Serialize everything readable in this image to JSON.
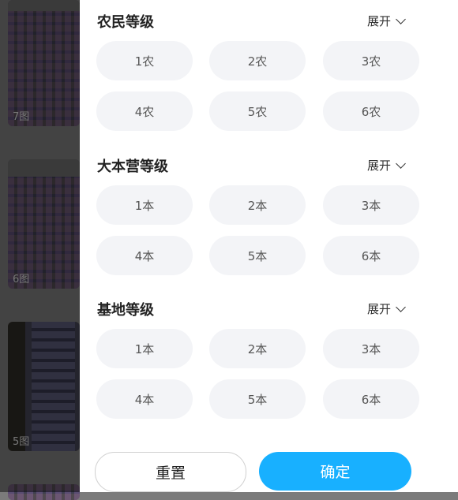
{
  "background": {
    "thumbnails": [
      {
        "count": "7图"
      },
      {
        "count": "6图"
      },
      {
        "count": "5图"
      }
    ]
  },
  "filters": [
    {
      "title": "农民等级",
      "expand": "展开",
      "options": [
        "1农",
        "2农",
        "3农",
        "4农",
        "5农",
        "6农"
      ]
    },
    {
      "title": "大本营等级",
      "expand": "展开",
      "options": [
        "1本",
        "2本",
        "3本",
        "4本",
        "5本",
        "6本"
      ]
    },
    {
      "title": "基地等级",
      "expand": "展开",
      "options": [
        "1本",
        "2本",
        "3本",
        "4本",
        "5本",
        "6本"
      ]
    }
  ],
  "actions": {
    "reset_label": "重置",
    "confirm_label": "确定"
  },
  "colors": {
    "accent": "#18b0ff",
    "chip_bg": "#f3f4f7"
  }
}
